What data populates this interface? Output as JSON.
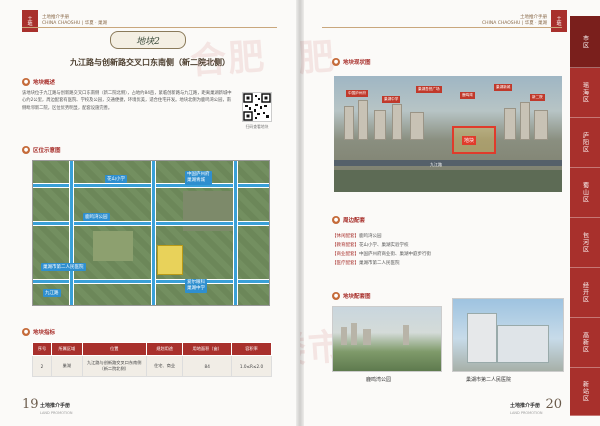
{
  "left_page": {
    "brand_seal": "土地",
    "brand_text": [
      "土地推介手册",
      "CHINA CHAOSHU | 华夏 · 巢湖"
    ],
    "badge": "地块2",
    "title": "九江路与创新路交叉口东南侧（新二院北侧）",
    "overview_head": "地块概述",
    "overview_text": "该地块位于九江路与创新路交叉口东南侧（新二院北侧），占地约84亩，紧临创新路与九江路，距离巢湖新城中心约2公里，周边配套有医院、学校及公园，交通便捷，环境优美，适合住宅开发。地块北侧为鹿鸣湾公园，南侧毗邻新二院，区位优势明显，配套设施完善。",
    "qr_caption": "扫码查看地块",
    "location_head": "区位示意图",
    "map_labels": {
      "school_top": "花山小学",
      "zhongguo_1": "中国庐州府",
      "zhongguo_2": "巢湖青城",
      "road_mid": "鹿鸣湾公园",
      "hospital": "巢湖市第二人民医院",
      "road_bottom": "九江路",
      "school_right_1": "爱尔眼科",
      "school_right_2": "巢湖中学"
    },
    "table_head": "地块指标",
    "table_headers": [
      "序号",
      "所属区域",
      "位置",
      "规划用途",
      "用地面积（亩）",
      "容积率"
    ],
    "table_rows": [
      [
        "2",
        "巢湖",
        "九江路与创新路交叉口东南侧（新二院北侧）",
        "住宅、商业",
        "84",
        "1.0≤R≤2.0"
      ]
    ],
    "page_number": "19",
    "page_caption": "土地推介手册",
    "page_sub": "LAND PROMOTION"
  },
  "right_page": {
    "brand_seal": "土地",
    "brand_text": [
      "土地推介手册",
      "CHINA CHAOSHU | 华夏 · 巢湖"
    ],
    "status_head": "地块现状图",
    "aerial_tags": [
      "中国庐州府",
      "巢湖中学",
      "巢湖吾悦广场",
      "鹿鸣湾",
      "巢湖新城",
      "新二院"
    ],
    "plot_label": "地块",
    "road_label": "九江路",
    "support_head": "周边配套",
    "support_rows": [
      {
        "key": "【休闲配套】",
        "val": "鹿鸣湾公园"
      },
      {
        "key": "【教育配套】",
        "val": "花山小学、巢湖实验学校"
      },
      {
        "key": "【商业配套】",
        "val": "中国庐州府商业街、巢湖中庭步行街"
      },
      {
        "key": "【医疗配套】",
        "val": "巢湖市第二人民医院"
      }
    ],
    "photos_head": "地块配套图",
    "photo_1_caption": "鹿鸣湾公园",
    "photo_2_caption": "巢湖市第二人民医院",
    "side_tabs": [
      "市区",
      "瑶海区",
      "庐阳区",
      "蜀山区",
      "包河区",
      "经开区",
      "高新区",
      "新站区"
    ],
    "page_number": "20",
    "page_caption": "土地推介手册",
    "page_sub": "LAND PROMOTION"
  },
  "watermark": [
    "合肥",
    "楼市"
  ],
  "colors": {
    "accent": "#a8302c",
    "plot": "#e8d25a",
    "road": "#3aa0d8"
  }
}
